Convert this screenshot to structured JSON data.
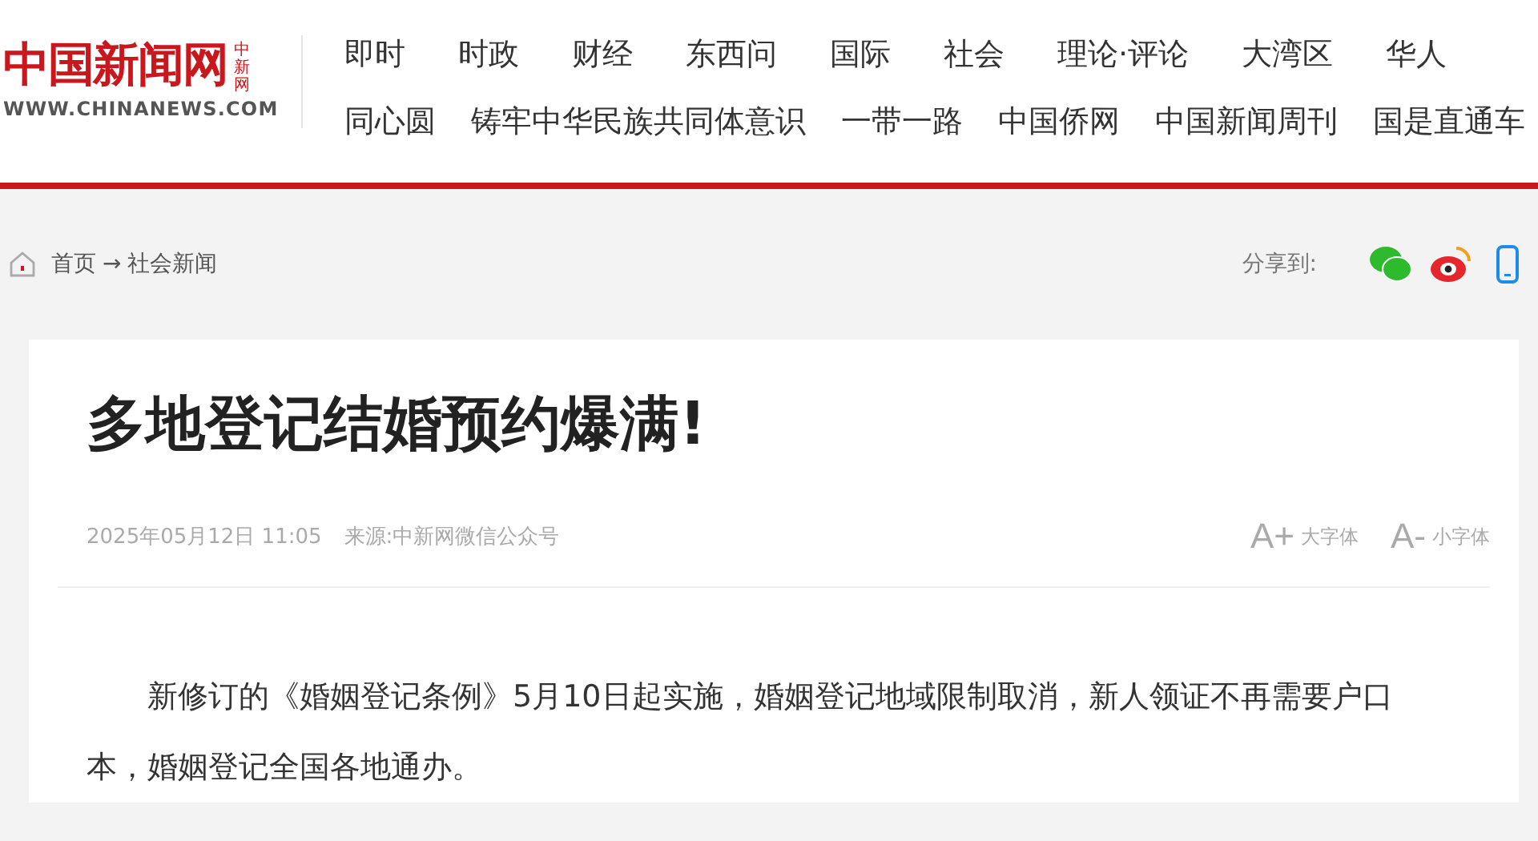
{
  "header": {
    "logo": "中国新闻网",
    "logo_badge": "中新网",
    "logo_url": "WWW.CHINANEWS.COM",
    "nav_rows": [
      [
        "即时",
        "时政",
        "财经",
        "东西问",
        "国际",
        "社会",
        "理论·评论",
        "大湾区",
        "华人"
      ],
      [
        "同心圆",
        "铸牢中华民族共同体意识",
        "一带一路",
        "中国侨网",
        "中国新闻周刊",
        "国是直通车"
      ]
    ]
  },
  "breadcrumb": {
    "home": "首页",
    "separator": "→",
    "section": "社会新闻"
  },
  "share": {
    "label": "分享到:"
  },
  "article": {
    "title": "多地登记结婚预约爆满!",
    "date": "2025年05月12日 11:05",
    "source": "来源:中新网微信公众号",
    "font_controls": [
      {
        "icon": "A+",
        "label": "大字体"
      },
      {
        "icon": "A-",
        "label": "小字体"
      }
    ],
    "paragraphs": [
      "新修订的《婚姻登记条例》5月10日起实施，婚姻登记地域限制取消，新人领证不再需要户口本，婚姻登记全国各地通办。"
    ]
  }
}
